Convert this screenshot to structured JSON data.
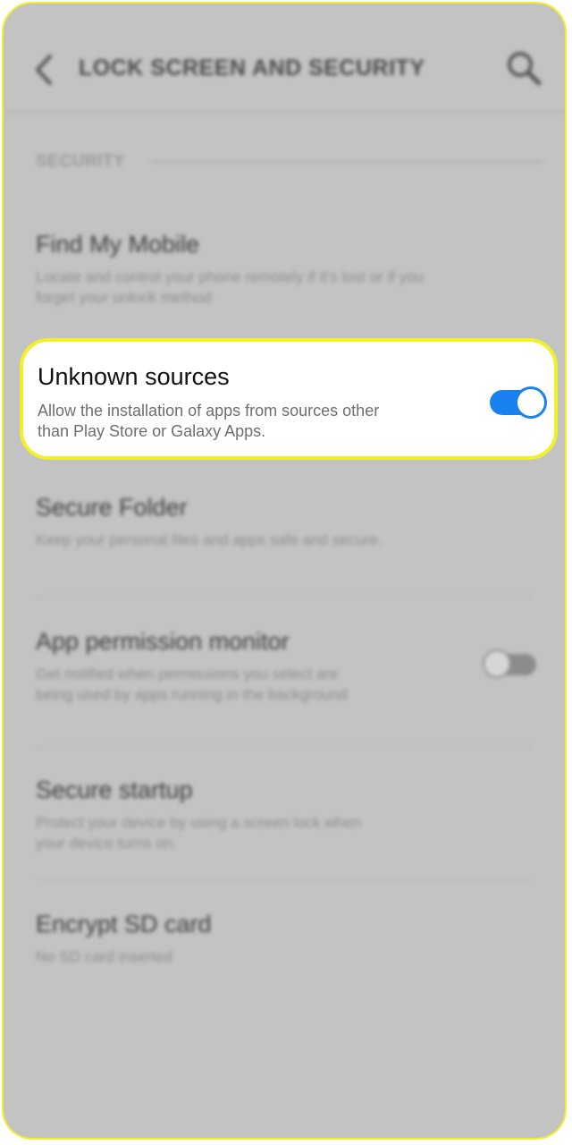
{
  "header": {
    "title": "LOCK SCREEN AND SECURITY",
    "back_icon": "chevron-left-icon",
    "search_icon": "search-icon"
  },
  "section": {
    "label": "SECURITY"
  },
  "items": [
    {
      "title": "Find My Mobile",
      "desc": "Locate and control your phone remotely if it's lost or if you forget your unlock method"
    },
    {
      "title": "Unknown sources",
      "desc": "Allow the installation of apps from sources other than Play Store or Galaxy Apps.",
      "toggle": "on"
    },
    {
      "title": "Secure Folder",
      "desc": "Keep your personal files and apps safe and secure."
    },
    {
      "title": "App permission monitor",
      "desc": "Get notified when permissions you select are being used by apps running in the background",
      "toggle": "off"
    },
    {
      "title": "Secure startup",
      "desc": "Protect your device by using a screen lock when your device turns on."
    },
    {
      "title": "Encrypt SD card",
      "desc": "No SD card inserted"
    }
  ],
  "colors": {
    "highlight_border": "#f2f02a",
    "toggle_on": "#1a82f0",
    "dim_background": "#c3c3c3"
  }
}
